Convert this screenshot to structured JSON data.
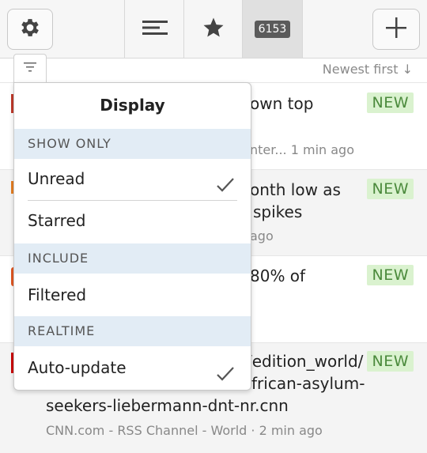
{
  "toolbar": {
    "gear_icon": "gear-icon",
    "sort_icon": "lines-icon",
    "star_icon": "star-icon",
    "unread_count": "6153",
    "plus_icon": "plus-icon"
  },
  "subheader": {
    "sort_label": "Newest first ↓"
  },
  "rows": [
    {
      "line1": "own top",
      "line2": "",
      "meta": "nter...  1 min ago",
      "badge": "NEW",
      "marker": "#c0392b"
    },
    {
      "line1": "onth low as",
      "line2": "spikes",
      "meta": "ago",
      "badge": "NEW",
      "marker": "#e67e22"
    },
    {
      "line1": "80% of",
      "line2": "",
      "meta": "",
      "badge": "NEW",
      "marker": "#e25822"
    },
    {
      "line1": "/edition_world/",
      "line2": "frican-asylum-",
      "line3": "seekers-liebermann-dnt-nr.cnn",
      "meta": "CNN.com - RSS Channel - World · 2 min ago",
      "badge": "NEW",
      "marker": "#cc0000"
    }
  ],
  "dropdown": {
    "title": "Display",
    "sections": {
      "show_only": "SHOW ONLY",
      "include": "INCLUDE",
      "realtime": "REALTIME"
    },
    "items": {
      "unread": {
        "label": "Unread",
        "checked": true
      },
      "starred": {
        "label": "Starred",
        "checked": false
      },
      "filtered": {
        "label": "Filtered",
        "checked": false
      },
      "auto_update": {
        "label": "Auto-update",
        "checked": true
      }
    }
  }
}
